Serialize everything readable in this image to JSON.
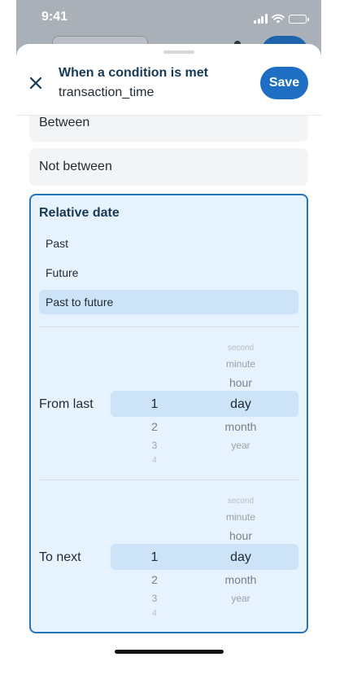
{
  "status_bar": {
    "time": "9:41"
  },
  "sheet": {
    "title": "When a condition is met",
    "subtitle": "transaction_time",
    "save_label": "Save",
    "close_icon": "close-icon"
  },
  "options": {
    "between": "Between",
    "not_between": "Not between"
  },
  "relative_date": {
    "title": "Relative date",
    "modes": [
      "Past",
      "Future",
      "Past to future"
    ],
    "selected_mode": "Past to future",
    "from_last": {
      "label": "From last",
      "numbers_above": [],
      "number": "1",
      "numbers_below": [
        "2",
        "3",
        "4"
      ],
      "units_above": [
        "second",
        "minute",
        "hour"
      ],
      "unit": "day",
      "units_below": [
        "month",
        "year"
      ]
    },
    "to_next": {
      "label": "To next",
      "numbers_above": [],
      "number": "1",
      "numbers_below": [
        "2",
        "3",
        "4"
      ],
      "units_above": [
        "second",
        "minute",
        "hour"
      ],
      "unit": "day",
      "units_below": [
        "month",
        "year"
      ]
    }
  },
  "colors": {
    "accent": "#1e6fc4",
    "selection": "#cde3f8",
    "card_bg": "#e6f2fd",
    "card_border": "#2575b8",
    "title_text": "#163a56"
  }
}
